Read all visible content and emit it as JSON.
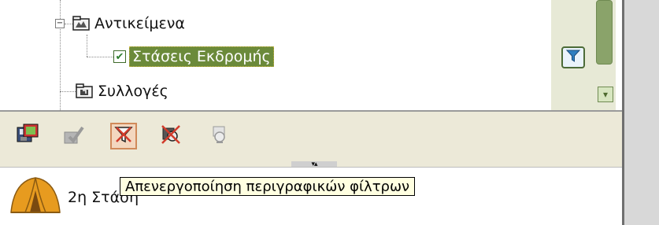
{
  "tree": {
    "items": [
      {
        "label": "Αντικείμενα",
        "expander": "−",
        "icon": "folder-map-icon"
      },
      {
        "label": "Στάσεις Εκδρομής",
        "checked": true,
        "icon": "checkbox-icon",
        "selected": true
      },
      {
        "label": "Συλλογές",
        "icon": "folder-collection-icon"
      }
    ]
  },
  "sidepane": {
    "filter_icon": "filter-funnel-icon",
    "scroll_down": "▾"
  },
  "toolbar": {
    "buttons": [
      {
        "icon": "save-map-icon",
        "enabled": true
      },
      {
        "icon": "edit-check-icon",
        "enabled": false
      },
      {
        "icon": "disable-filters-icon",
        "enabled": true,
        "active": true
      },
      {
        "icon": "remove-filter-icon",
        "enabled": true
      },
      {
        "icon": "filter-options-icon",
        "enabled": false
      }
    ],
    "splitter_glyph": "▾▴"
  },
  "content": {
    "station_label": "2η Στάση"
  },
  "tooltip": {
    "text": "Απενεργοποίηση περιγραφικών φίλτρων"
  },
  "colors": {
    "selection_bg": "#6b8a3a",
    "toolbar_bg": "#ece9d8",
    "sidepane_bg": "#e7e9d6",
    "tooltip_bg": "#ffffe1"
  }
}
